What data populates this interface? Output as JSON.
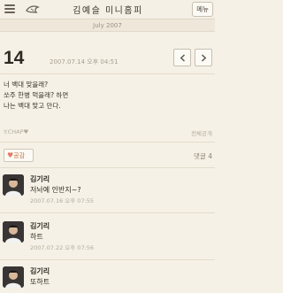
{
  "header": {
    "title": "김예슬 미니홈피",
    "menu_label": "메뉴",
    "menu_icon": "hamburger-icon",
    "logo_icon": "bird-icon"
  },
  "date_bar": {
    "label": "July 2007"
  },
  "post": {
    "day": "14",
    "datetime": "2007.07.14 오후 04:51",
    "body_lines": [
      "너 백대 맞을래?",
      "쏘주 한병 먹을래? 하면",
      "나는 백대 맞고 만다."
    ],
    "author": "Y.CHAP",
    "privacy": "전체공개"
  },
  "actions": {
    "like_label": "공감",
    "comment_count": "댓글 4"
  },
  "comments": [
    {
      "name": "김기리",
      "text": "저놔예 인반지~?",
      "time": "2007.07.16 오후 07:55"
    },
    {
      "name": "김기리",
      "text": "하트",
      "time": "2007.07.22 오후 07:56"
    },
    {
      "name": "김기리",
      "text": "또하트",
      "time": ""
    }
  ],
  "colors": {
    "background": "#f6f1e6",
    "accent": "#c0703a",
    "heart": "#e47a62"
  }
}
